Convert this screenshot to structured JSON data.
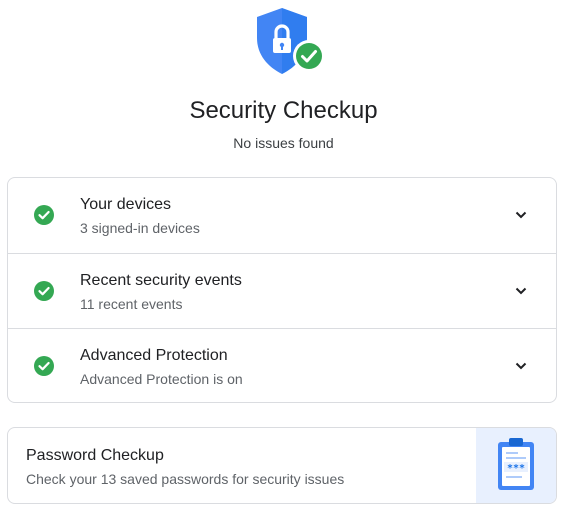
{
  "header": {
    "icon": "shield-lock-check-icon",
    "title": "Security Checkup",
    "subtitle": "No issues found"
  },
  "checks": [
    {
      "icon": "check-circle-icon",
      "label": "Your devices",
      "detail": "3 signed-in devices"
    },
    {
      "icon": "check-circle-icon",
      "label": "Recent security events",
      "detail": "11 recent events"
    },
    {
      "icon": "check-circle-icon",
      "label": "Advanced Protection",
      "detail": "Advanced Protection is on"
    }
  ],
  "password_checkup": {
    "label": "Password Checkup",
    "detail": "Check your 13 saved passwords for security issues",
    "icon": "password-clipboard-icon",
    "masked_text": "***"
  },
  "colors": {
    "shield_blue": "#4285f4",
    "success_green": "#34a853",
    "card_border": "#dadce0",
    "illustration_bg": "#e8f0fe"
  }
}
